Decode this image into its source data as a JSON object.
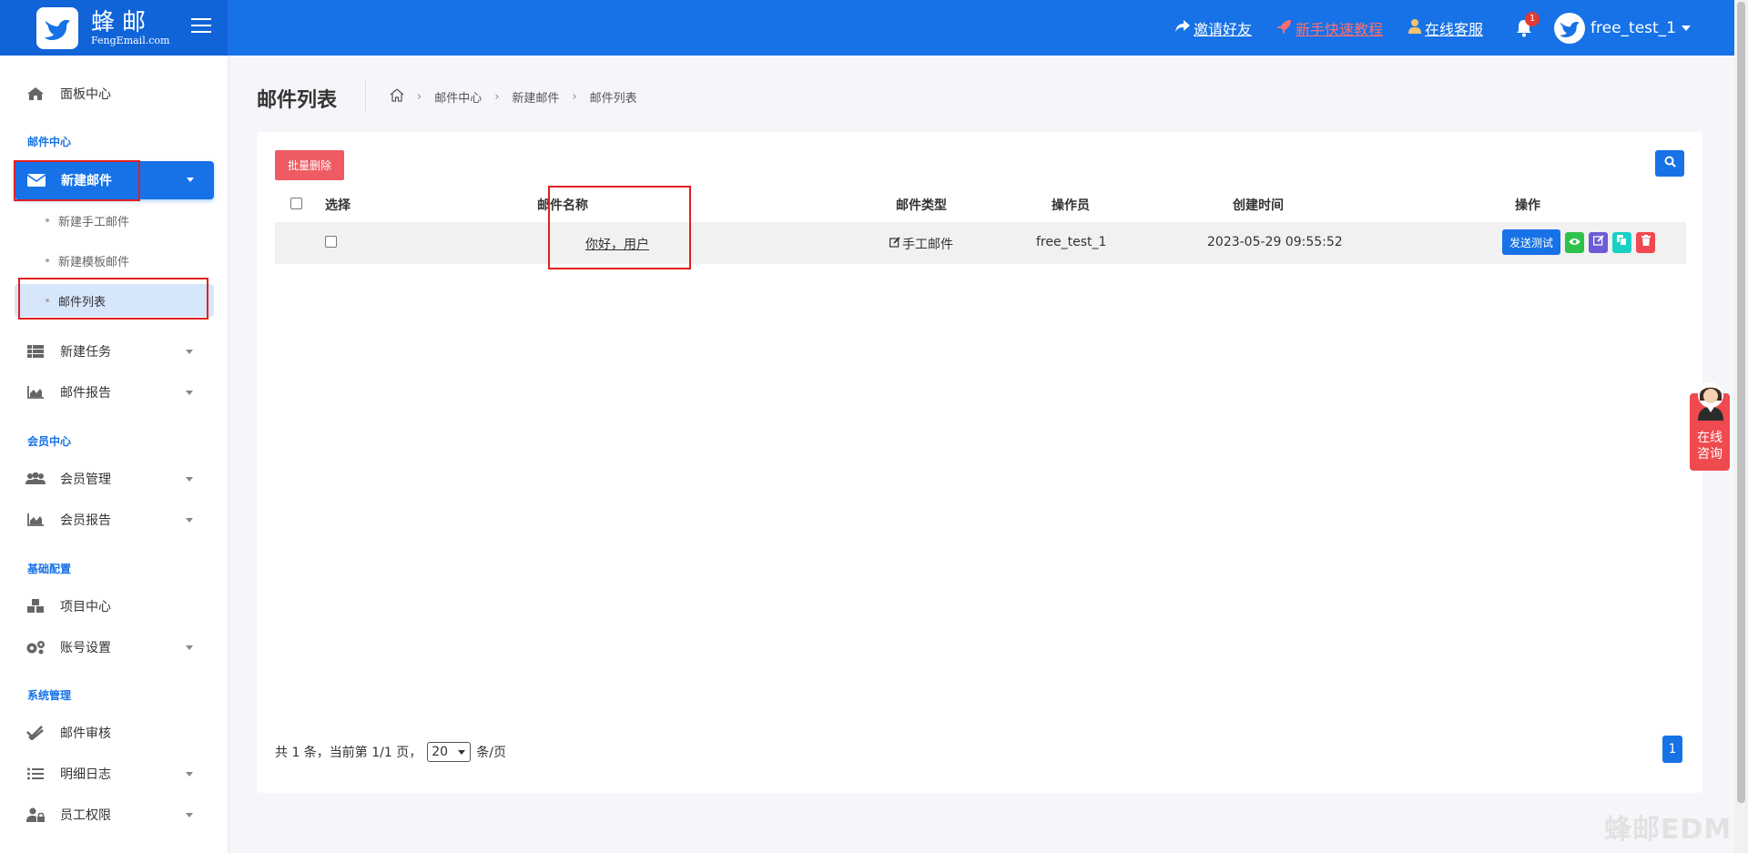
{
  "header": {
    "logo_cn": "蜂邮",
    "logo_en": "FengEmail.com",
    "invite": "邀请好友",
    "tutorial": "新手快速教程",
    "support": "在线客服",
    "notification_count": "1",
    "username": "free_test_1"
  },
  "sidebar": {
    "dashboard": "面板中心",
    "section_mail": "邮件中心",
    "new_mail": "新建邮件",
    "new_manual_mail": "新建手工邮件",
    "new_template_mail": "新建模板邮件",
    "mail_list": "邮件列表",
    "new_task": "新建任务",
    "mail_report": "邮件报告",
    "section_member": "会员中心",
    "member_manage": "会员管理",
    "member_report": "会员报告",
    "section_basic": "基础配置",
    "project_center": "项目中心",
    "account_settings": "账号设置",
    "section_system": "系统管理",
    "mail_review": "邮件审核",
    "detail_log": "明细日志",
    "staff_permission": "员工权限"
  },
  "page": {
    "title": "邮件列表",
    "breadcrumb": [
      "邮件中心",
      "新建邮件",
      "邮件列表"
    ]
  },
  "toolbar": {
    "batch_delete": "批量删除"
  },
  "table": {
    "headers": {
      "select": "选择",
      "name": "邮件名称",
      "type": "邮件类型",
      "operator": "操作员",
      "created": "创建时间",
      "actions": "操作"
    },
    "rows": [
      {
        "name": "你好，用户",
        "type": "手工邮件",
        "operator": "free_test_1",
        "created": "2023-05-29 09:55:52",
        "send_test": "发送测试"
      }
    ]
  },
  "pagination": {
    "prefix": "共 1 条，当前第 1/1 页，",
    "page_size": "20",
    "suffix": "条/页",
    "current_page": "1"
  },
  "consult": {
    "label_line1": "在线",
    "label_line2": "咨询"
  },
  "watermark": "蜂邮EDM",
  "colors": {
    "primary": "#1672e6",
    "danger": "#ef5b62",
    "view": "#2fc24a",
    "edit": "#6e5bd6",
    "copy": "#1ccfc4",
    "delete": "#ef4a4f"
  }
}
